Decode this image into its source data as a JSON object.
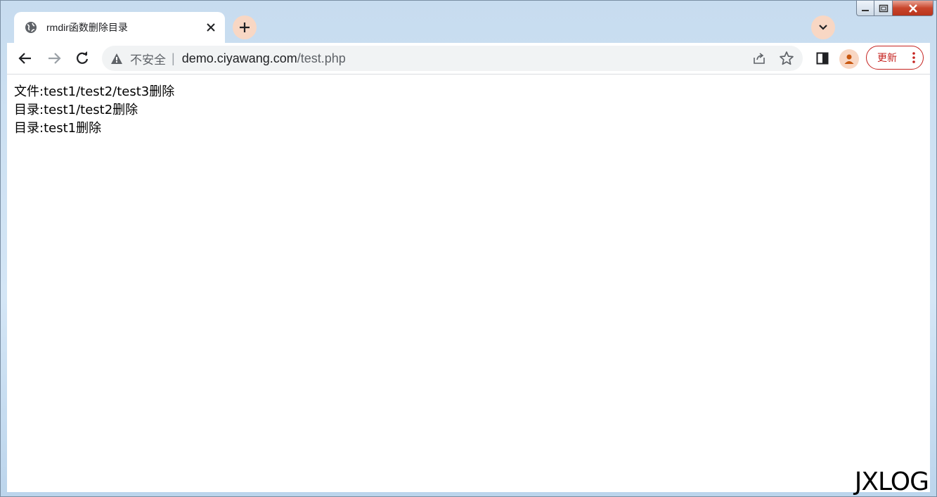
{
  "tab": {
    "title": "rmdir函数删除目录",
    "favicon": "globe-icon"
  },
  "toolbar": {
    "security_label": "不安全",
    "separator": "|",
    "url_host": "demo.ciyawang.com",
    "url_path": "/test.php",
    "update_label": "更新"
  },
  "page": {
    "lines": [
      "文件:test1/test2/test3删除",
      "目录:test1/test2删除",
      "目录:test1删除"
    ]
  },
  "watermark": "JXLOG",
  "colors": {
    "accent": "#f8d7c4",
    "update_border": "#c5221f",
    "close_button": "#c9452c"
  }
}
